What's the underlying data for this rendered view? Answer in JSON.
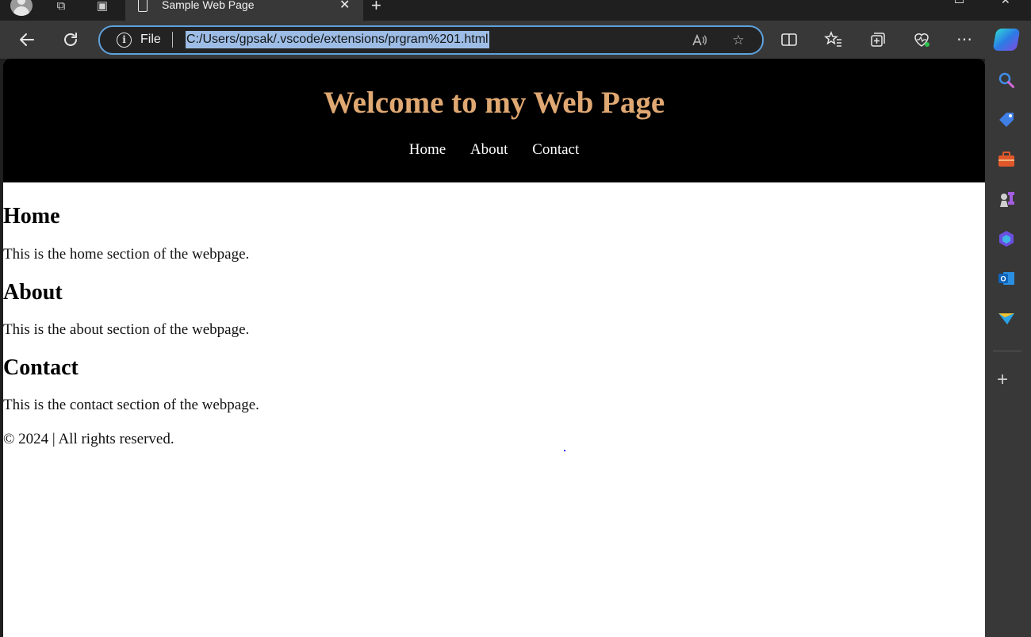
{
  "browser": {
    "tab": {
      "title": "Sample Web Page",
      "close_glyph": "✕"
    },
    "new_tab_glyph": "+",
    "address_bar": {
      "scheme_label": "File",
      "url": "C:/Users/gpsak/.vscode/extensions/prgram%201.html"
    },
    "toolbar_icons": [
      "back-icon",
      "refresh-icon",
      "info-icon",
      "read-aloud-icon",
      "star-icon",
      "split-screen-icon",
      "favorites-icon",
      "collections-icon",
      "browser-essentials-icon",
      "more-icon"
    ],
    "sidebar_icons": [
      "search-icon",
      "shopping-icon",
      "tools-icon",
      "games-icon",
      "copilot-icon",
      "outlook-icon",
      "send-icon",
      "add-icon"
    ],
    "colors": {
      "address_border": "#5fa2dd",
      "url_highlight": "#9dbde6",
      "chrome_bg": "#383838"
    }
  },
  "page": {
    "header": {
      "title": "Welcome to my Web Page",
      "title_color": "#e0a872",
      "nav": [
        "Home",
        "About",
        "Contact"
      ]
    },
    "sections": [
      {
        "heading": "Home",
        "text": "This is the home section of the webpage."
      },
      {
        "heading": "About",
        "text": "This is the about section of the webpage."
      },
      {
        "heading": "Contact",
        "text": "This is the contact section of the webpage."
      }
    ],
    "footer": "© 2024 | All rights reserved."
  }
}
